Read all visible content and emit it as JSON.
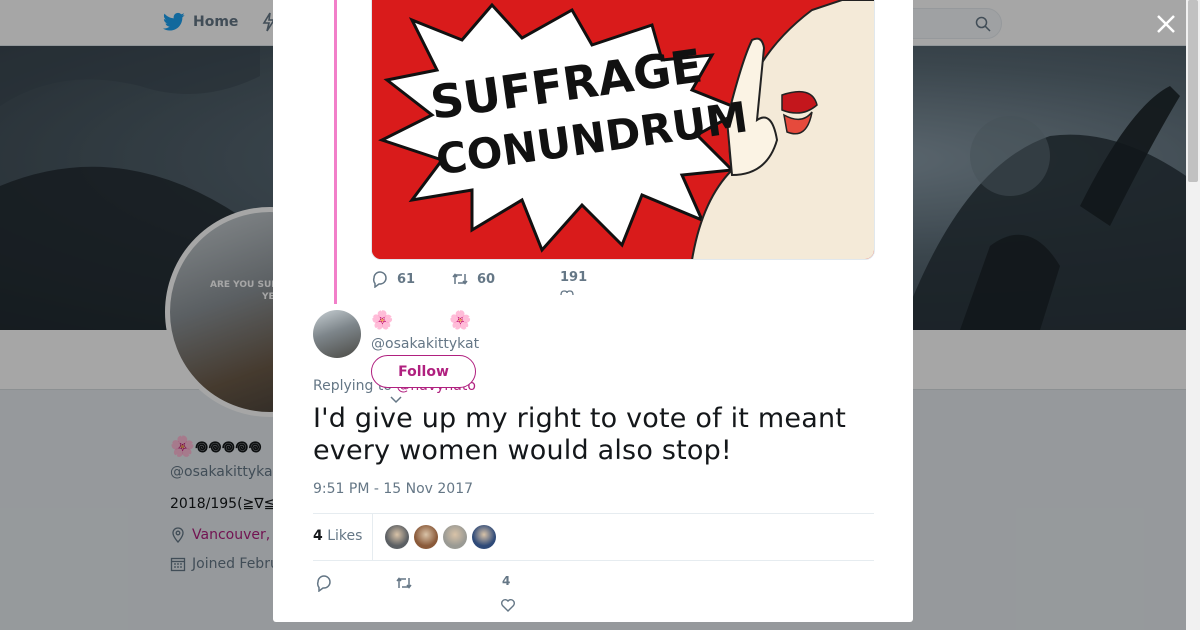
{
  "nav": {
    "home_label": "Home"
  },
  "profile": {
    "name": "🌸𖦹𖦹𖦹𖦹𖦹",
    "handle": "@osakakittyka",
    "bio": "2018/195(≧∇≦",
    "location": "Vancouver, ",
    "joined": "Joined Febru",
    "avatar_sign_1": "ARE YOU SURE?",
    "avatar_sign_2": "YE AL"
  },
  "parent_tweet": {
    "image_text_line1": "SUFFRAGE",
    "image_text_line2": "CONUNDRUM",
    "reply_count": "61",
    "retweet_count": "60",
    "like_count": "191"
  },
  "tweet": {
    "flower_1": "🌸",
    "flower_2": "🌸",
    "handle": "@osakakittykat",
    "follow_label": "Follow",
    "replying_prefix": "Replying to ",
    "replying_mention": "@navyhato",
    "text": "I'd give up my right to vote of it meant every women would also stop!",
    "timestamp": "9:51 PM - 15 Nov 2017",
    "likes_count": "4",
    "likes_label": " Likes",
    "like_action_count": "4"
  },
  "likers": [
    {
      "color": "#5b5f63"
    },
    {
      "color": "#8a5a3a"
    },
    {
      "color": "#9a9a94"
    },
    {
      "color": "#2f4a78"
    }
  ],
  "colors": {
    "accent": "#b0207f",
    "thread_line": "#f27fc9",
    "image_red": "#d91b1b",
    "twitter_blue": "#1da1f2"
  },
  "icons": [
    "twitter-bird-icon",
    "search-icon",
    "close-icon",
    "reply-icon",
    "retweet-icon",
    "heart-icon",
    "chevron-down-icon",
    "location-icon",
    "calendar-icon"
  ]
}
